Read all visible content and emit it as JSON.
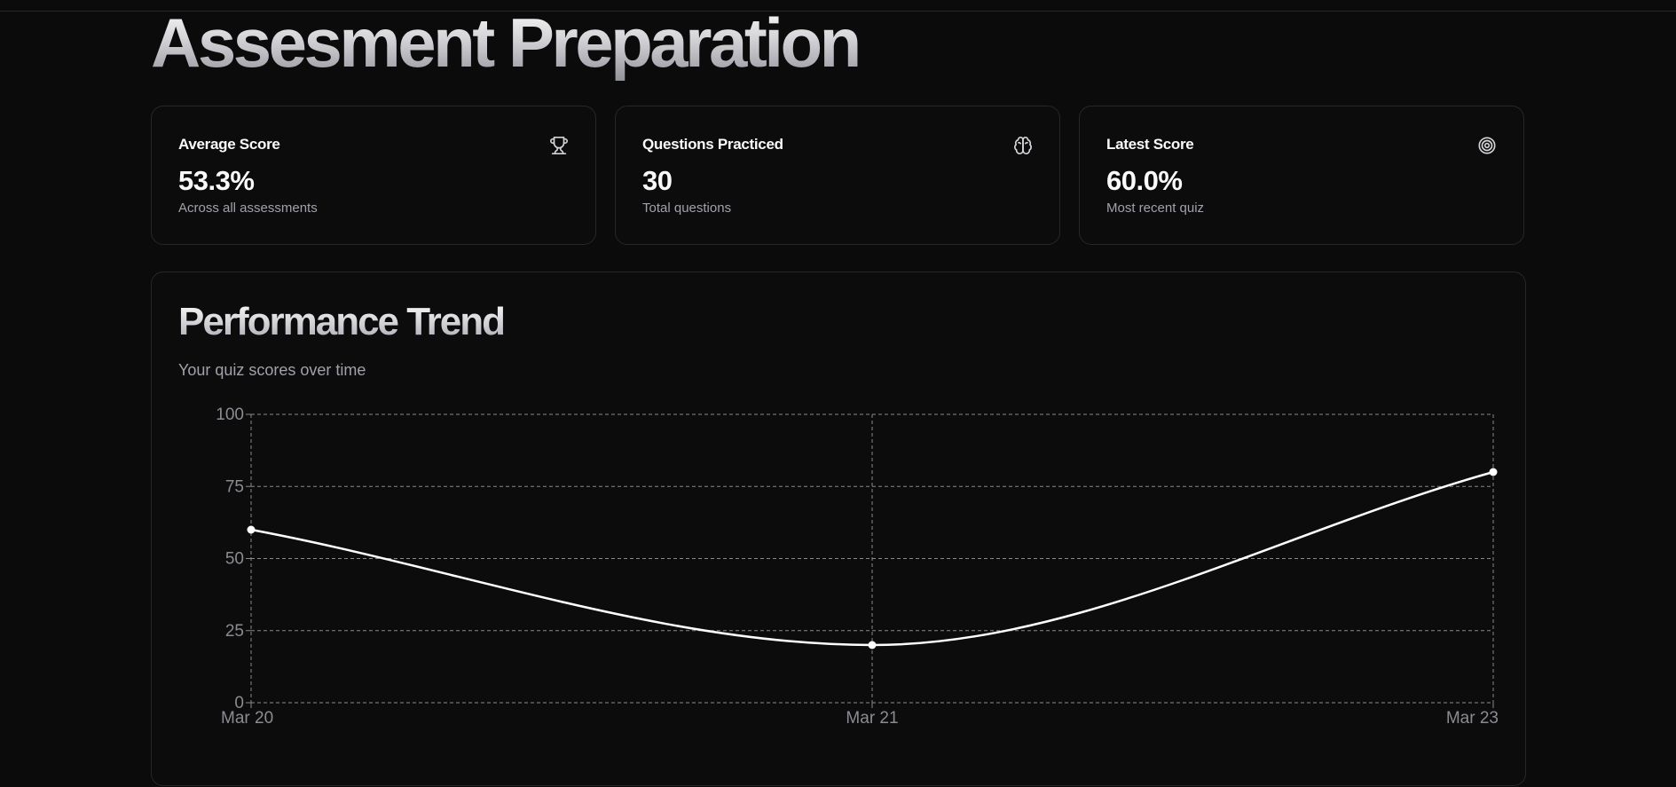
{
  "page": {
    "title": "Assesment Preparation"
  },
  "stats": [
    {
      "title": "Average Score",
      "value": "53.3%",
      "subtitle": "Across all assessments",
      "icon": "trophy-icon"
    },
    {
      "title": "Questions Practiced",
      "value": "30",
      "subtitle": "Total questions",
      "icon": "brain-icon"
    },
    {
      "title": "Latest Score",
      "value": "60.0%",
      "subtitle": "Most recent quiz",
      "icon": "target-icon"
    }
  ],
  "performance": {
    "title": "Performance Trend",
    "subtitle": "Your quiz scores over time"
  },
  "colors": {
    "background": "#0b0b0c",
    "card_border": "#27272a",
    "line": "#ffffff",
    "grid": "#8a8a8f",
    "muted_text": "#a1a1aa"
  },
  "chart_data": {
    "type": "line",
    "categories": [
      "Mar 20",
      "Mar 21",
      "Mar 23"
    ],
    "series": [
      {
        "values": [
          60,
          20,
          80
        ]
      }
    ],
    "ylim": [
      0,
      100
    ],
    "yticks": [
      "0",
      "25",
      "50",
      "75",
      "100"
    ],
    "grid": true,
    "curve": "smooth"
  }
}
